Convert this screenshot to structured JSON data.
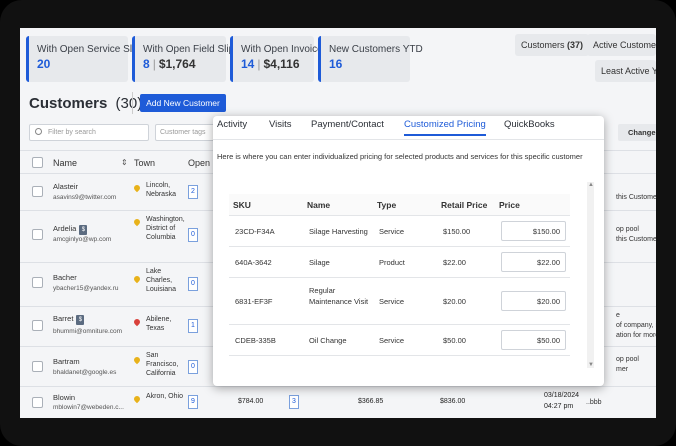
{
  "stats": [
    {
      "label": "With Open Service Slips",
      "count": "20",
      "amount": ""
    },
    {
      "label": "With Open Field Slips",
      "count": "8",
      "amount": "$1,764"
    },
    {
      "label": "With Open Invoices",
      "count": "14",
      "amount": "$4,116"
    },
    {
      "label": "New Customers YTD",
      "count": "16",
      "amount": ""
    }
  ],
  "top_tabs": {
    "customers_label": "Customers",
    "customers_count": "(37)",
    "active_customers": "Active Customers",
    "least_active": "Least Active YTD"
  },
  "page": {
    "title": "Customers",
    "count": "(30)",
    "add_button": "Add New Customer",
    "search_placeholder": "Filter by search",
    "tags_placeholder": "Customer tags",
    "change_button": "Change S"
  },
  "table_headers": {
    "name": "Name",
    "town": "Town",
    "open": "Open F"
  },
  "customers": [
    {
      "name": "Alasteir",
      "email": "asavins9@twitter.com",
      "town": "Lincoln, Nebraska",
      "count": "2",
      "badge": "",
      "note": [
        "this Customer n"
      ]
    },
    {
      "name": "Ardelia",
      "email": "amcginlyo@wp.com",
      "town": "Washington, District of Columbia",
      "count": "0",
      "badge": "$",
      "note": [
        "op pool",
        "this Customer"
      ]
    },
    {
      "name": "Bacher",
      "email": "ybacher15@yandex.ru",
      "town": "Lake Charles, Louisiana",
      "count": "0",
      "badge": "",
      "note": []
    },
    {
      "name": "Barret",
      "email": "bhummi@omniture.com",
      "town": "Abilene, Texas",
      "count": "1",
      "badge": "$",
      "note": [
        "e",
        "of company, inc",
        "ation for more v"
      ]
    },
    {
      "name": "Bartram",
      "email": "bhaldanet@google.es",
      "town": "San Francisco, California",
      "count": "0",
      "badge": "",
      "note": [
        "op pool",
        "mer"
      ]
    },
    {
      "name": "Blowin",
      "email": "mblowin7@webeden.c...",
      "town": "Akron, Ohio",
      "count": "9",
      "badge": "",
      "note": [
        "..bbb"
      ]
    }
  ],
  "last_row_extra": {
    "a": "$784.00",
    "b": "3",
    "c": "$366.85",
    "d": "$836.00",
    "date": "03/18/2024",
    "time": "04:27 pm"
  },
  "modal": {
    "tabs": [
      "Activity",
      "Visits",
      "Payment/Contact",
      "Customized Pricing",
      "QuickBooks"
    ],
    "active_tab": "Customized Pricing",
    "description": "Here is where you can enter individualized pricing for selected products and services for this specific customer",
    "columns": [
      "SKU",
      "Name",
      "Type",
      "Retail Price",
      "Price"
    ],
    "rows": [
      {
        "sku": "23CD-F34A",
        "name": "Silage Harvesting",
        "type": "Service",
        "retail": "$150.00",
        "price": "$150.00"
      },
      {
        "sku": "640A-3642",
        "name": "Silage",
        "type": "Product",
        "retail": "$22.00",
        "price": "$22.00"
      },
      {
        "sku": "6831-EF3F",
        "name": "Regular Maintenance Visit",
        "type": "Service",
        "retail": "$20.00",
        "price": "$20.00"
      },
      {
        "sku": "CDEB-335B",
        "name": "Oil Change",
        "type": "Service",
        "retail": "$50.00",
        "price": "$50.00"
      }
    ]
  }
}
